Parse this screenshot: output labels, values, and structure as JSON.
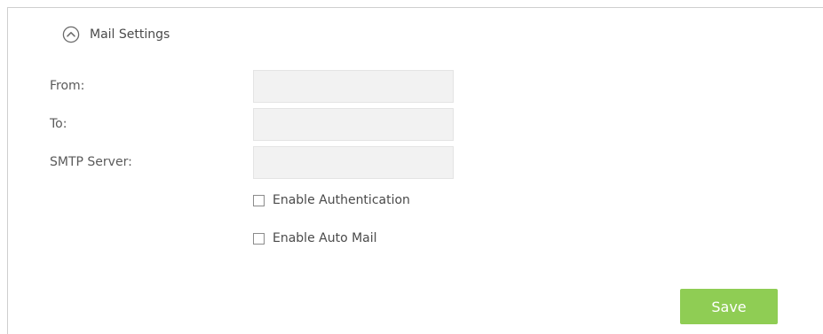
{
  "section": {
    "title": "Mail Settings",
    "icon": "chevron-up-circle-icon",
    "expanded": true
  },
  "form": {
    "from": {
      "label": "From:",
      "value": "",
      "placeholder": ""
    },
    "to": {
      "label": "To:",
      "value": "",
      "placeholder": ""
    },
    "smtp_server": {
      "label": "SMTP Server:",
      "value": "",
      "placeholder": ""
    }
  },
  "options": {
    "enable_authentication": {
      "label": "Enable Authentication",
      "checked": false
    },
    "enable_auto_mail": {
      "label": "Enable Auto Mail",
      "checked": false
    }
  },
  "actions": {
    "save_label": "Save"
  },
  "colors": {
    "save_button": "#8fcd54",
    "input_background": "#f2f2f2",
    "panel_border": "#cfcfcf",
    "text": "#555555"
  }
}
